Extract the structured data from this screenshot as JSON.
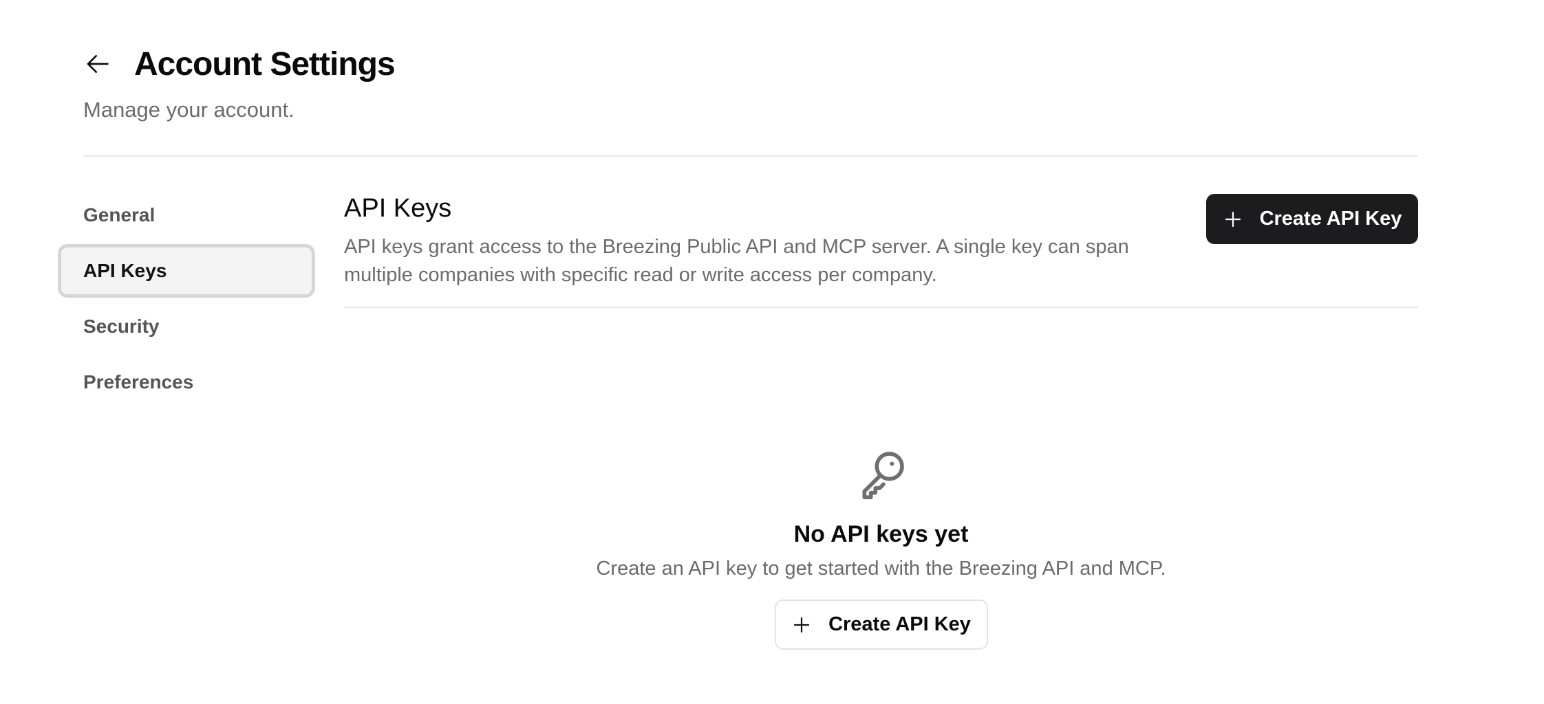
{
  "header": {
    "title": "Account Settings",
    "subtitle": "Manage your account.",
    "back_icon": "arrow-left-icon"
  },
  "sidebar": {
    "items": [
      {
        "label": "General",
        "active": false
      },
      {
        "label": "API Keys",
        "active": true
      },
      {
        "label": "Security",
        "active": false
      },
      {
        "label": "Preferences",
        "active": false
      }
    ]
  },
  "main": {
    "section_title": "API Keys",
    "section_description": "API keys grant access to the Breezing Public API and MCP server. A single key can span multiple companies with specific read or write access per company.",
    "create_button_label": "Create API Key",
    "create_button_icon": "plus-icon"
  },
  "empty_state": {
    "icon": "key-icon",
    "title": "No API keys yet",
    "description": "Create an API key to get started with the Breezing API and MCP.",
    "button_label": "Create API Key",
    "button_icon": "plus-icon"
  },
  "colors": {
    "primary_button_bg": "#1c1c1e",
    "active_nav_bg": "#f4f4f4",
    "active_nav_border": "#d6d6d6",
    "muted_text": "#6b6b6b"
  }
}
